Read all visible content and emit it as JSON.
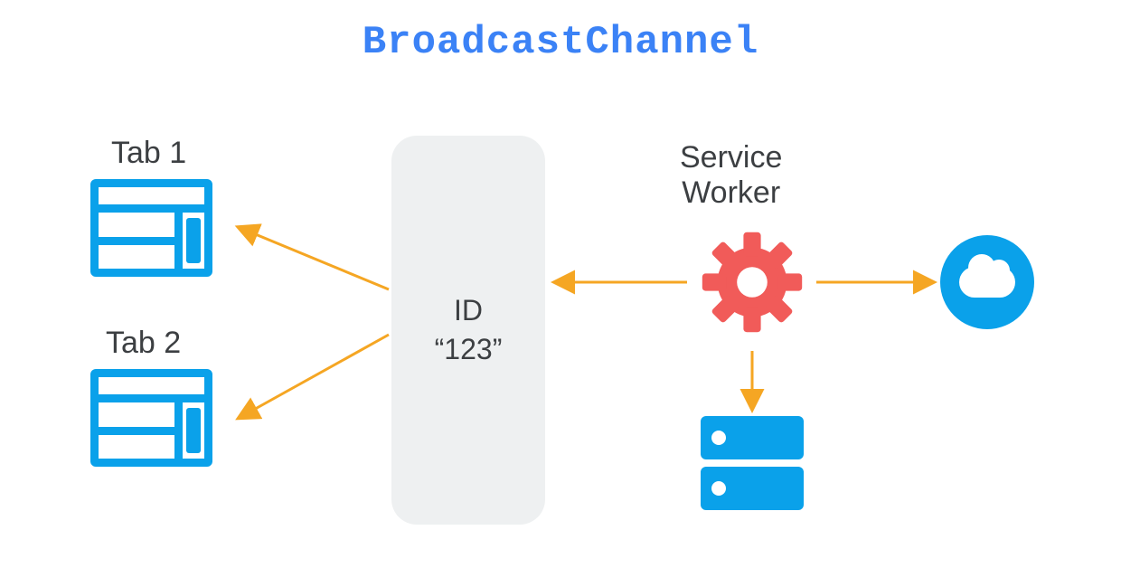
{
  "title": "BroadcastChannel",
  "tabs": [
    {
      "label": "Tab 1"
    },
    {
      "label": "Tab 2"
    }
  ],
  "channel": {
    "id_label": "ID",
    "id_value": "“123”"
  },
  "service_worker": {
    "label_line1": "Service",
    "label_line2": "Worker"
  },
  "icons": {
    "tab": "browser-window-icon",
    "gear": "gear-icon",
    "cloud": "cloud-icon",
    "storage": "server-storage-icon"
  },
  "colors": {
    "accent_blue": "#0aa1ea",
    "title_blue": "#3b82f6",
    "gear_red": "#f15b59",
    "arrow": "#f5a623",
    "panel": "#eef0f1",
    "text": "#3c3f42"
  }
}
